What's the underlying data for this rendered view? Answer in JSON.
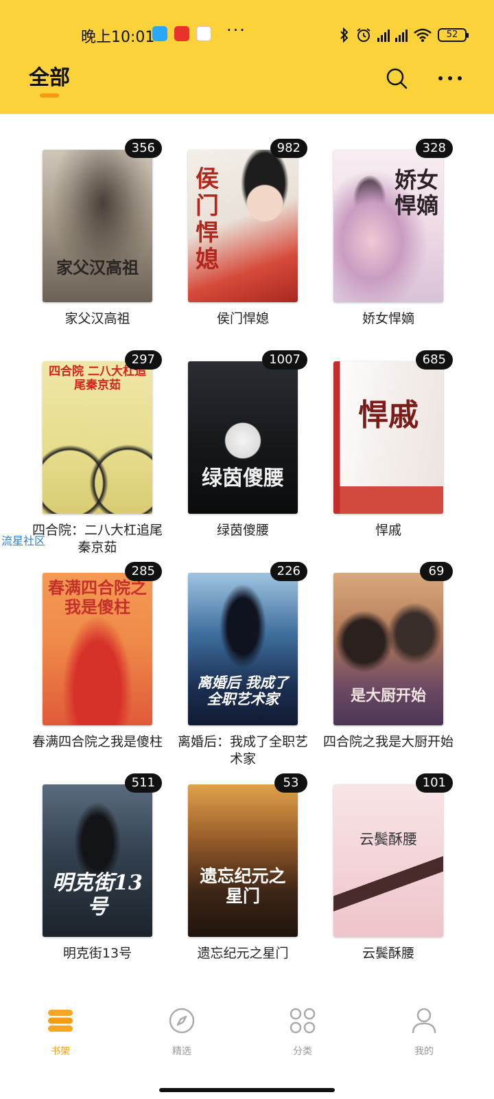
{
  "status_bar": {
    "time": "晚上10:01",
    "more": "···",
    "battery": "52",
    "icons": [
      "app-blue-icon",
      "app-red-icon",
      "app-pink-icon",
      "bluetooth-icon",
      "alarm-icon",
      "hd-signal-icon",
      "signal-icon",
      "wifi-icon",
      "battery-icon"
    ]
  },
  "header": {
    "title": "全部",
    "accent": "#fcd23a",
    "underline_color": "#f39c12"
  },
  "books": [
    {
      "title": "家父汉高祖",
      "count": "356",
      "cover_text": "家父汉高祖"
    },
    {
      "title": "侯门悍媳",
      "count": "982",
      "cover_text": "侯门悍媳"
    },
    {
      "title": "娇女悍嫡",
      "count": "328",
      "cover_text": "娇女悍嫡"
    },
    {
      "title": "四合院：二八大杠追尾秦京茹",
      "count": "297",
      "cover_text": "四合院 二八大杠追尾秦京茹"
    },
    {
      "title": "绿茵傻腰",
      "count": "1007",
      "cover_text": "绿茵傻腰"
    },
    {
      "title": "悍戚",
      "count": "685",
      "cover_text": "悍戚"
    },
    {
      "title": "春满四合院之我是傻柱",
      "count": "285",
      "cover_text": "春满四合院之我是傻柱"
    },
    {
      "title": "离婚后：我成了全职艺术家",
      "count": "226",
      "cover_text": "离婚后 我成了全职艺术家"
    },
    {
      "title": "四合院之我是大厨开始",
      "count": "69",
      "cover_text": "是大厨开始"
    },
    {
      "title": "明克街13号",
      "count": "511",
      "cover_text": "明克街13号"
    },
    {
      "title": "遗忘纪元之星门",
      "count": "53",
      "cover_text": "遗忘纪元之星门"
    },
    {
      "title": "云鬓酥腰",
      "count": "101",
      "cover_text": "云鬓酥腰"
    }
  ],
  "side_link": "流星社区",
  "bottom_nav": [
    {
      "label": "书架",
      "icon": "bookshelf-icon",
      "active": true
    },
    {
      "label": "精选",
      "icon": "compass-icon",
      "active": false
    },
    {
      "label": "分类",
      "icon": "category-grid-icon",
      "active": false
    },
    {
      "label": "我的",
      "icon": "user-icon",
      "active": false
    }
  ]
}
